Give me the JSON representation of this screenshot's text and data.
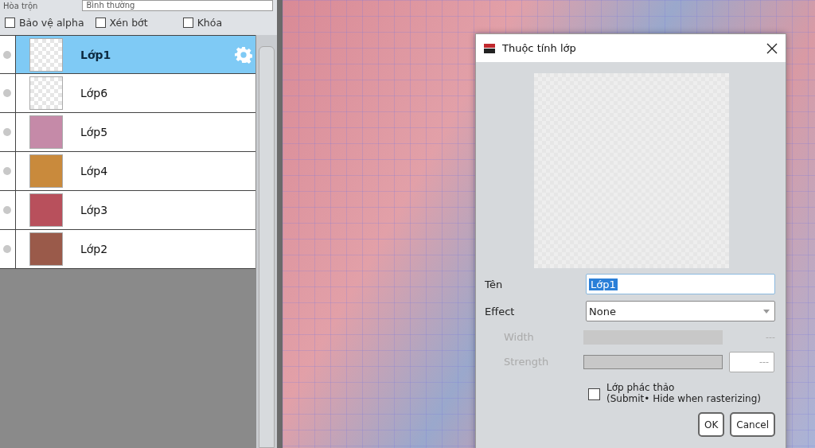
{
  "blend": {
    "label": "Hòa trộn",
    "value": "Bình thường"
  },
  "options": [
    {
      "label": "Bảo vệ alpha",
      "checked": false
    },
    {
      "label": "Xén bớt",
      "checked": false
    },
    {
      "label": "Khóa",
      "checked": false
    }
  ],
  "layers": [
    {
      "name": "Lớp1",
      "selected": true,
      "kind": "transparent"
    },
    {
      "name": "Lớp6",
      "selected": false,
      "kind": "transparent"
    },
    {
      "name": "Lớp5",
      "selected": false,
      "kind": "image",
      "color": "#c58aa8"
    },
    {
      "name": "Lớp4",
      "selected": false,
      "kind": "image",
      "color": "#c98a3c"
    },
    {
      "name": "Lớp3",
      "selected": false,
      "kind": "image",
      "color": "#b8505c"
    },
    {
      "name": "Lớp2",
      "selected": false,
      "kind": "image",
      "color": "#9a5a4a"
    }
  ],
  "dialog": {
    "title": "Thuộc tính lớp",
    "fields": [
      {
        "kind": "text",
        "label": "Tên",
        "value": "Lớp1",
        "disabled": false
      },
      {
        "kind": "select",
        "label": "Effect",
        "value": "None",
        "disabled": false
      },
      {
        "kind": "slider",
        "label": "Width",
        "value": "---",
        "disabled": true
      },
      {
        "kind": "slider-box",
        "label": "Strength",
        "value": "---",
        "disabled": true
      }
    ],
    "checkbox": {
      "label": "Lớp phác thảo",
      "note": "(Submit• Hide when rasterizing)",
      "checked": false
    },
    "buttons": [
      "OK",
      "Cancel"
    ]
  }
}
